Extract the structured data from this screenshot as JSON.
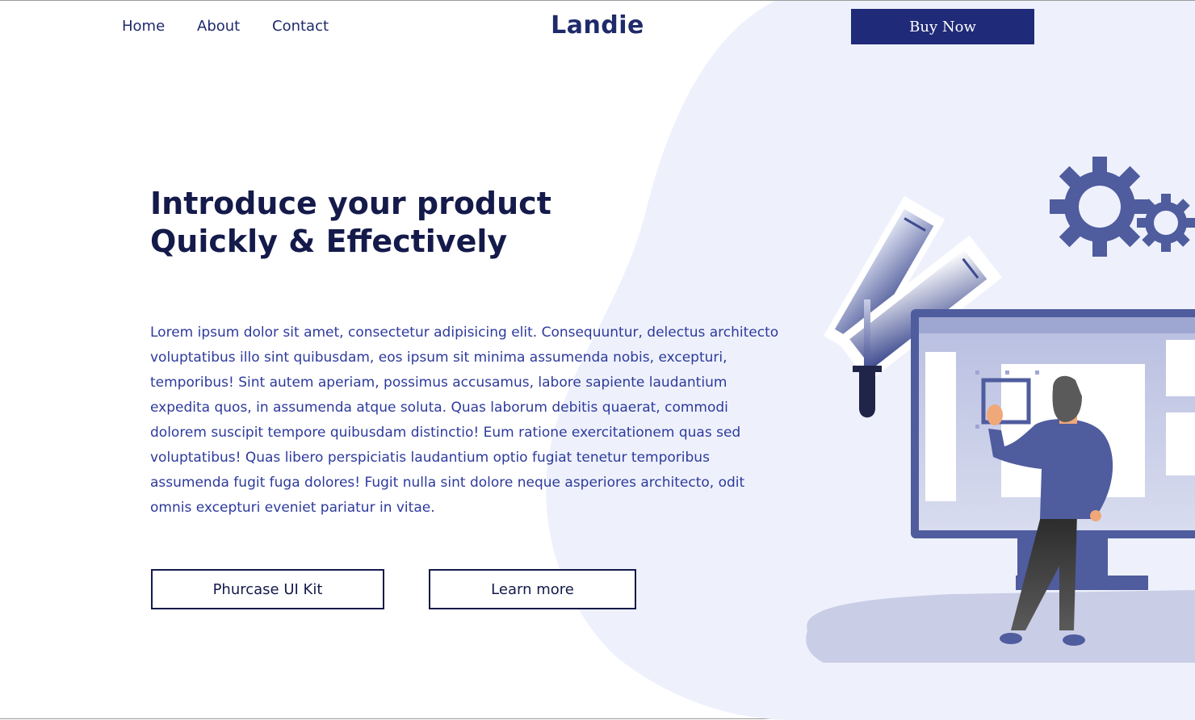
{
  "nav": {
    "links": [
      {
        "label": "Home"
      },
      {
        "label": "About"
      },
      {
        "label": "Contact"
      }
    ],
    "brand": "Landie",
    "buy_label": "Buy Now"
  },
  "hero": {
    "title_line1": "Introduce your product",
    "title_line2": "Quickly & Effectively",
    "body": "Lorem ipsum dolor sit amet, consectetur adipisicing elit. Consequuntur, delectus architecto voluptatibus illo sint quibusdam, eos ipsum sit minima assumenda nobis, excepturi, temporibus! Sint autem aperiam, possimus accusamus, labore sapiente laudantium expedita quos, in assumenda atque soluta. Quas laborum debitis quaerat, commodi dolorem suscipit tempore quibusdam distinctio! Eum ratione exercitationem quas sed voluptatibus! Quas libero perspiciatis laudantium optio fugiat tenetur temporibus assumenda fugit fuga dolores! Fugit nulla sint dolore neque asperiores architecto, odit omnis excepturi eveniet pariatur in vitae.",
    "primary_label": "Phurcase UI Kit",
    "secondary_label": "Learn more"
  },
  "colors": {
    "brand": "#1f2a6b",
    "button_fill": "#1f2a78",
    "accent": "#4f5c9e",
    "blob": "#eef1fc"
  },
  "icons": {
    "gear": "gear-icon",
    "swatch": "color-swatch-icon",
    "dropper": "eyedropper-icon",
    "monitor": "monitor-icon"
  }
}
